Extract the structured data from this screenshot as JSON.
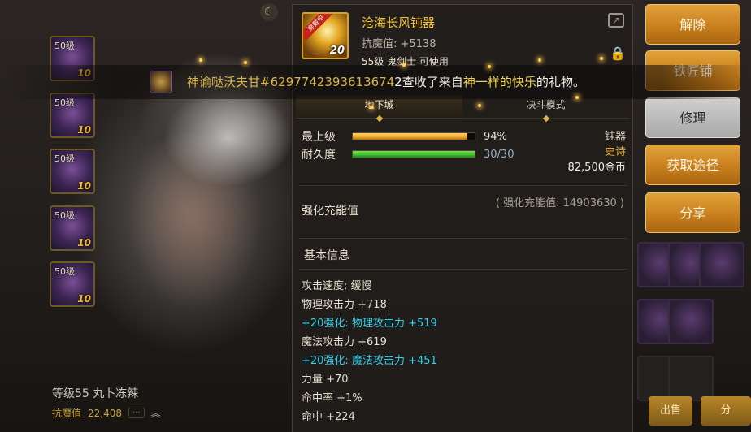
{
  "character": {
    "level_name": "等级55 丸卜冻辣",
    "power_label": "抗魔值",
    "power_value": "22,408"
  },
  "left_slots": [
    {
      "level": "50级",
      "plus": "10"
    },
    {
      "level": "50级",
      "plus": "10"
    },
    {
      "level": "50级",
      "plus": "10"
    },
    {
      "level": "50级",
      "plus": "10"
    },
    {
      "level": "50级",
      "plus": "10"
    }
  ],
  "broadcast": {
    "sender": "神谕哒沃夫甘#6297742393613674",
    "middle": "2查收了来自",
    "gift": "神一样的快乐",
    "end": "的礼物。"
  },
  "item": {
    "equipped_badge": "穿戴中",
    "plus": "20",
    "name": "沧海长风钝器",
    "resist_label": "抗魔值:",
    "resist_value": "+5138",
    "requirement": "55级 鬼剑士 可使用",
    "tabs": [
      "地下城",
      "决斗模式"
    ],
    "active_tab": 0,
    "max_level_label": "最上级",
    "max_level_value": "94%",
    "max_level_fraction": 0.94,
    "durability_label": "耐久度",
    "durability_value": "30/30",
    "durability_fraction": 1.0,
    "weapon_type": "钝器",
    "rarity": "史诗",
    "price": "82,500金币",
    "enhance_energy": "( 强化充能值: 14903630 )",
    "enhance_label": "强化充能值",
    "basic_header": "基本信息",
    "stats": [
      {
        "text": "攻击速度: 缓慢",
        "style": "norm"
      },
      {
        "text": "物理攻击力 +718",
        "style": "norm"
      },
      {
        "text": "+20强化: 物理攻击力 +519",
        "style": "cyan"
      },
      {
        "text": "魔法攻击力 +619",
        "style": "norm"
      },
      {
        "text": "+20强化: 魔法攻击力 +451",
        "style": "cyan"
      },
      {
        "text": "力量 +70",
        "style": "norm"
      },
      {
        "text": "命中率 +1%",
        "style": "norm"
      },
      {
        "text": "命中 +224",
        "style": "norm"
      }
    ]
  },
  "actions": {
    "dismantle": "解除",
    "blacksmith": "铁匠铺",
    "repair": "修理",
    "obtain": "获取途径",
    "share": "分享"
  },
  "bottom_buttons": {
    "sell": "出售",
    "split": "分"
  },
  "colors": {
    "gold_name": "#f5c430",
    "cyan_bonus": "#33cfe8",
    "bar_orange": "#f0a82a",
    "bar_green": "#3fbf2a"
  }
}
